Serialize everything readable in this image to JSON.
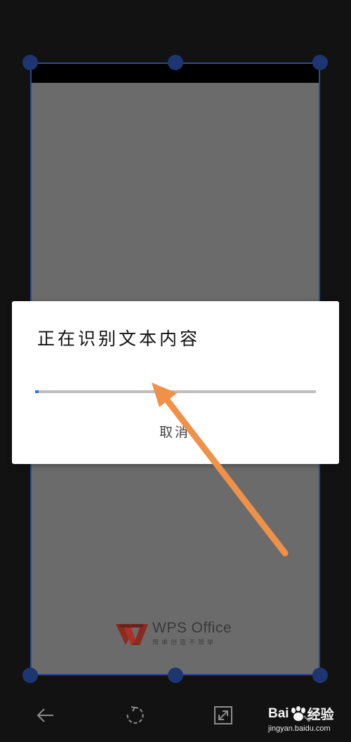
{
  "dialog": {
    "title": "正在识别文本内容",
    "progress_fraction": 0.012,
    "cancel_label": "取消"
  },
  "document_preview": {
    "logo_name": "WPS Office",
    "logo_slogan": "简单创造不简单"
  },
  "toolbar": {
    "items": [
      {
        "icon": "back-arrow-icon"
      },
      {
        "icon": "rotate-icon"
      },
      {
        "icon": "expand-icon"
      },
      {
        "icon": "confirm-icon"
      }
    ]
  },
  "watermark": {
    "brand_left": "Bai",
    "brand_right": "经验",
    "url": "jingyan.baidu.com"
  },
  "colors": {
    "background": "#121212",
    "crop_border": "#2b4a8f",
    "handle": "#1d3570",
    "progress_fill": "#2b78e4",
    "annotation_arrow": "#f0914a"
  }
}
